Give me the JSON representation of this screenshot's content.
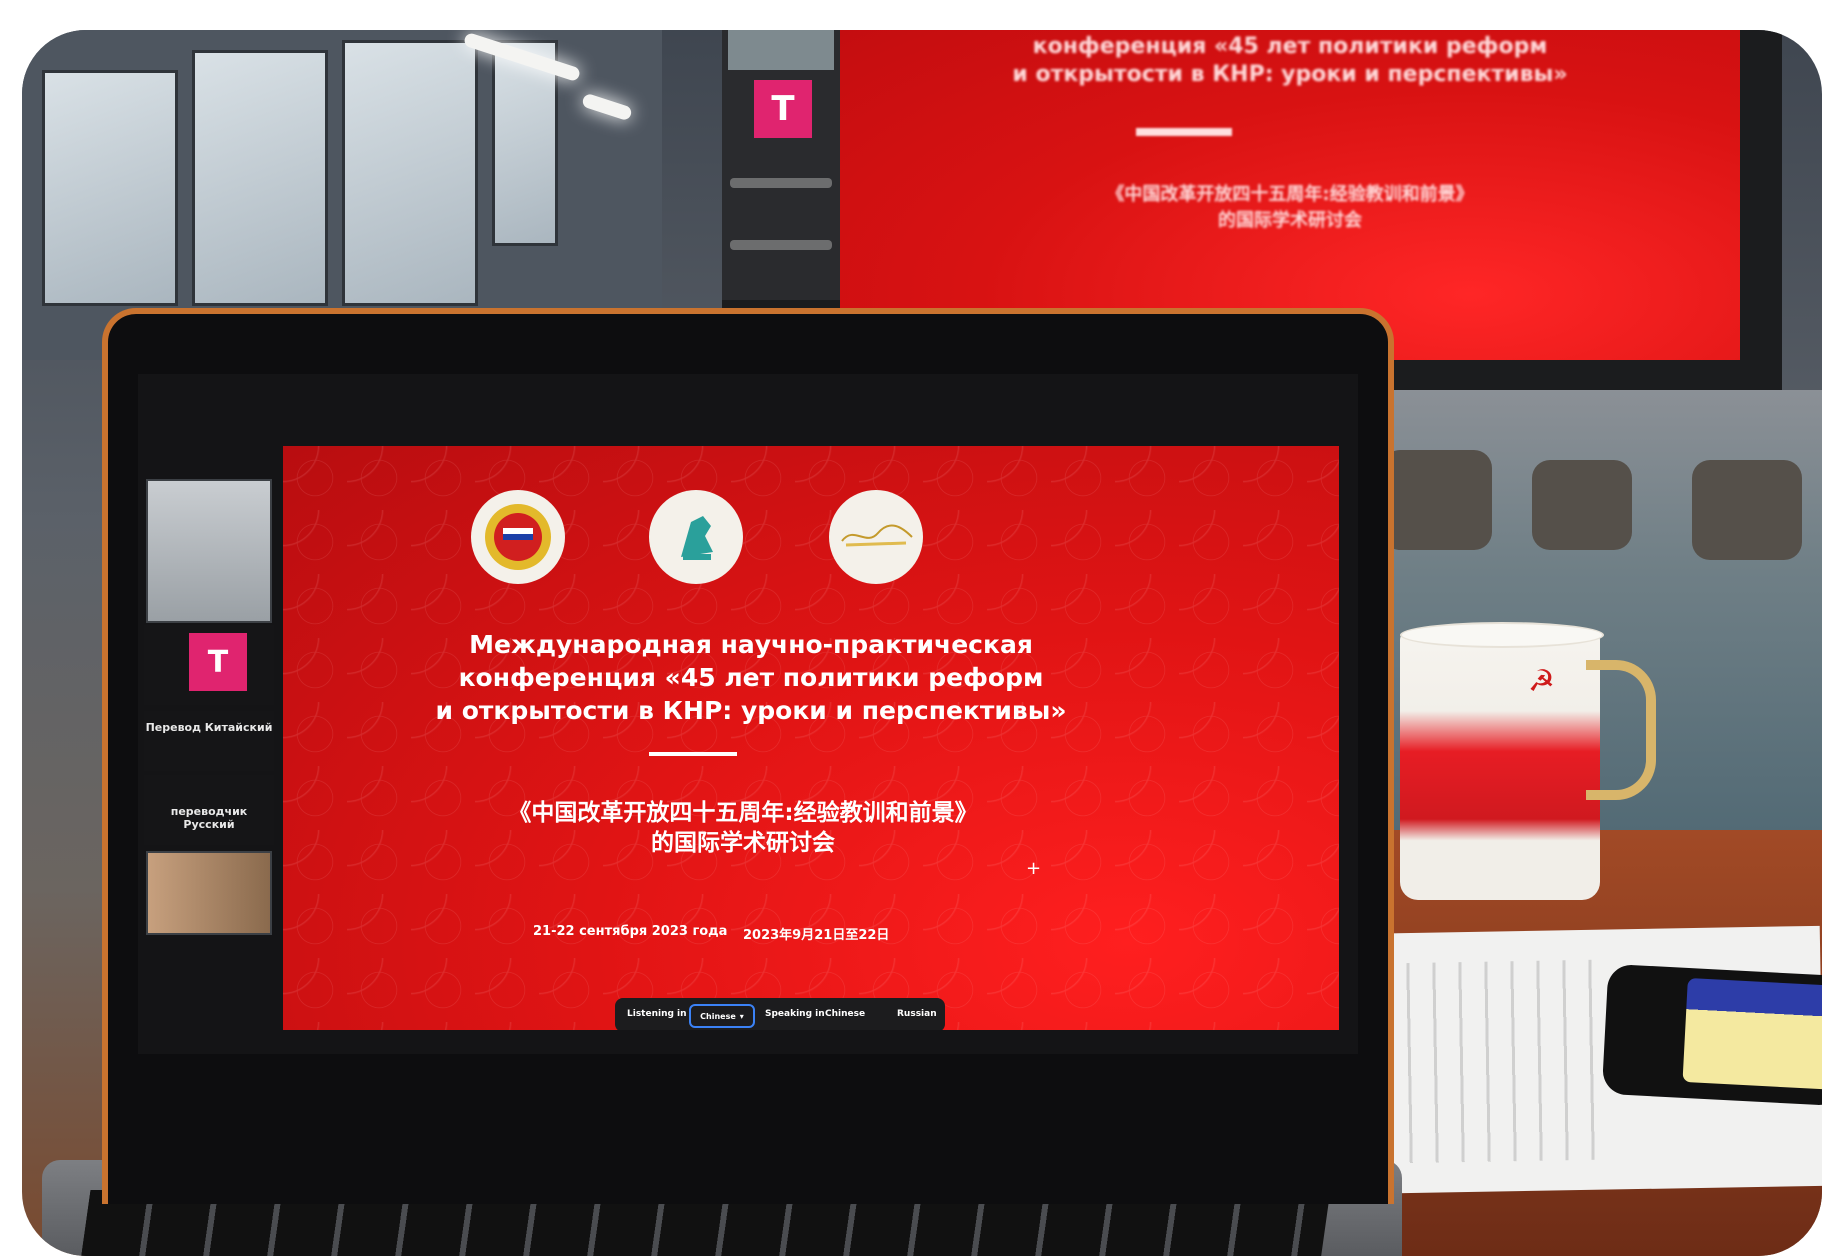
{
  "slide": {
    "title_lines": [
      "Международная научно-практическая",
      "конференция «45 лет политики реформ",
      "и открытости в КНР: уроки и перспективы»"
    ],
    "cn_lines": [
      "《中国改革开放四十五周年:经验教训和前景》",
      "的国际学术研讨会"
    ],
    "date_ru": "21-22 сентября 2023 года",
    "date_cn": "2023年9月21日至22日"
  },
  "participants": {
    "avatar_letter": "T",
    "name_1": "Перевод Китайский",
    "name_2": "переводчик Русский"
  },
  "interpretation": {
    "listening_label": "Listening in",
    "listening_value": "Chinese",
    "speaking_label": "Speaking in",
    "speaking_value": "Chinese",
    "other_option": "Russian"
  },
  "tv": {
    "title_lines": [
      "конференция «45 лет политики реформ",
      "и открытости в КНР: уроки и перспективы»"
    ],
    "cn_lines": [
      "《中国改革开放四十五周年:经验教训和前景》",
      "的国际学术研讨会"
    ],
    "avatar_letter": "T"
  },
  "colors": {
    "slide_red": "#e01414",
    "avatar_pink": "#e0246f",
    "laptop_orange": "#c9732f"
  }
}
